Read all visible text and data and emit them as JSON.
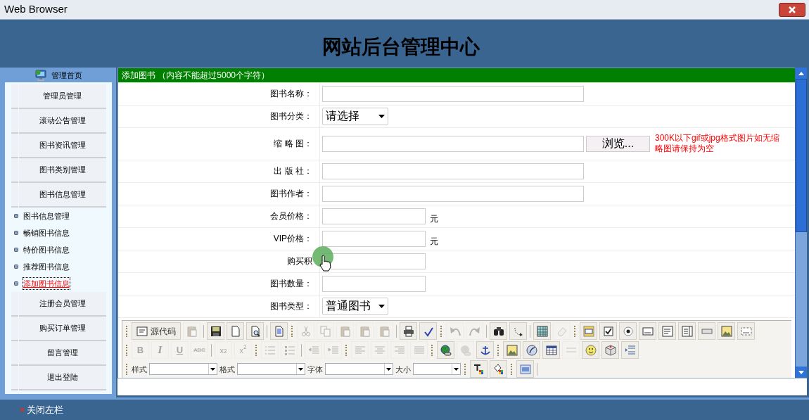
{
  "window": {
    "title": "Web Browser"
  },
  "header": {
    "title": "网站后台管理中心"
  },
  "sidebar": {
    "home": "管理首页",
    "items": [
      {
        "kind": "section",
        "label": "管理员管理"
      },
      {
        "kind": "section",
        "label": "滚动公告管理"
      },
      {
        "kind": "section",
        "label": "图书资讯管理"
      },
      {
        "kind": "section",
        "label": "图书类别管理"
      },
      {
        "kind": "section",
        "label": "图书信息管理"
      },
      {
        "kind": "link",
        "label": "图书信息管理",
        "selected": false
      },
      {
        "kind": "link",
        "label": "畅销图书信息",
        "selected": false
      },
      {
        "kind": "link",
        "label": "特价图书信息",
        "selected": false
      },
      {
        "kind": "link",
        "label": "推荐图书信息",
        "selected": false
      },
      {
        "kind": "link",
        "label": "添加图书信息",
        "selected": true
      },
      {
        "kind": "section",
        "label": "注册会员管理"
      },
      {
        "kind": "section",
        "label": "购买订单管理"
      },
      {
        "kind": "section",
        "label": "留言管理"
      },
      {
        "kind": "section",
        "label": "退出登陆"
      }
    ]
  },
  "form": {
    "title": "添加图书 （内容不能超过5000个字符）",
    "fields": [
      {
        "kind": "text",
        "label": "图书名称："
      },
      {
        "kind": "select",
        "label": "图书分类：",
        "value": "请选择"
      },
      {
        "kind": "file",
        "label": "缩 略 图：",
        "button": "浏览...",
        "hint": "300K以下gif或jpg格式图片如无缩略图请保持为空"
      },
      {
        "kind": "text",
        "label": "出 版 社："
      },
      {
        "kind": "text",
        "label": "图书作者："
      },
      {
        "kind": "short",
        "label": "会员价格：",
        "unit": "元"
      },
      {
        "kind": "short",
        "label": "VIP价格：",
        "unit": "元"
      },
      {
        "kind": "short",
        "label": "购买积"
      },
      {
        "kind": "short",
        "label": "图书数量："
      },
      {
        "kind": "select",
        "label": "图书类型：",
        "value": "普通图书"
      }
    ]
  },
  "editor": {
    "toolbars": [
      {
        "items": [
          {
            "kind": "grip"
          },
          {
            "kind": "labeled",
            "text": "源代码",
            "disabled": false
          },
          {
            "kind": "icon",
            "disabled": true
          },
          {
            "kind": "sep"
          },
          {
            "kind": "icon",
            "disabled": false
          },
          {
            "kind": "icon",
            "disabled": false
          },
          {
            "kind": "icon",
            "disabled": false
          },
          {
            "kind": "sep"
          },
          {
            "kind": "icon",
            "disabled": false
          },
          {
            "kind": "grip"
          },
          {
            "kind": "icon",
            "disabled": true
          },
          {
            "kind": "icon",
            "disabled": true
          },
          {
            "kind": "icon",
            "disabled": true
          },
          {
            "kind": "icon",
            "disabled": true
          },
          {
            "kind": "icon",
            "disabled": true
          },
          {
            "kind": "sep"
          },
          {
            "kind": "icon",
            "disabled": false
          },
          {
            "kind": "icon",
            "disabled": false
          },
          {
            "kind": "grip"
          },
          {
            "kind": "icon",
            "disabled": true
          },
          {
            "kind": "icon",
            "disabled": true
          },
          {
            "kind": "sep"
          },
          {
            "kind": "icon",
            "disabled": false
          },
          {
            "kind": "icon",
            "disabled": false
          },
          {
            "kind": "sep"
          },
          {
            "kind": "icon",
            "disabled": false
          },
          {
            "kind": "icon",
            "disabled": true
          },
          {
            "kind": "grip"
          },
          {
            "kind": "icon",
            "disabled": false
          },
          {
            "kind": "icon",
            "disabled": false
          },
          {
            "kind": "icon",
            "disabled": false
          },
          {
            "kind": "icon",
            "disabled": false
          },
          {
            "kind": "icon",
            "disabled": false
          },
          {
            "kind": "icon",
            "disabled": false
          },
          {
            "kind": "icon",
            "disabled": false
          },
          {
            "kind": "icon",
            "disabled": false
          },
          {
            "kind": "icon",
            "disabled": false
          }
        ]
      },
      {
        "items": [
          {
            "kind": "grip"
          },
          {
            "kind": "text",
            "text": "B",
            "disabled": true
          },
          {
            "kind": "text",
            "text": "I",
            "disabled": true
          },
          {
            "kind": "text",
            "text": "U",
            "disabled": true
          },
          {
            "kind": "text",
            "text": "ABC",
            "disabled": true
          },
          {
            "kind": "sep"
          },
          {
            "kind": "text",
            "text": "x$_{2}$",
            "disabled": true
          },
          {
            "kind": "text",
            "text": "x$^{2}$",
            "disabled": true
          },
          {
            "kind": "grip"
          },
          {
            "kind": "icon",
            "disabled": true
          },
          {
            "kind": "icon",
            "disabled": true
          },
          {
            "kind": "sep"
          },
          {
            "kind": "icon",
            "disabled": true
          },
          {
            "kind": "icon",
            "disabled": true
          },
          {
            "kind": "grip"
          },
          {
            "kind": "icon",
            "disabled": true
          },
          {
            "kind": "icon",
            "disabled": true
          },
          {
            "kind": "icon",
            "disabled": true
          },
          {
            "kind": "icon",
            "disabled": true
          },
          {
            "kind": "grip"
          },
          {
            "kind": "icon",
            "disabled": false
          },
          {
            "kind": "icon",
            "disabled": true
          },
          {
            "kind": "icon",
            "disabled": false
          },
          {
            "kind": "grip"
          },
          {
            "kind": "icon",
            "disabled": false
          },
          {
            "kind": "icon",
            "disabled": false
          },
          {
            "kind": "icon",
            "disabled": false
          },
          {
            "kind": "icon",
            "disabled": true
          },
          {
            "kind": "icon",
            "disabled": false
          },
          {
            "kind": "icon",
            "disabled": false
          },
          {
            "kind": "icon",
            "disabled": false
          }
        ]
      },
      {
        "items": [
          {
            "kind": "grip"
          },
          {
            "kind": "label",
            "text": "样式"
          },
          {
            "kind": "dropdown"
          },
          {
            "kind": "label",
            "text": "格式"
          },
          {
            "kind": "dropdown"
          },
          {
            "kind": "label",
            "text": "字体"
          },
          {
            "kind": "dropdown"
          },
          {
            "kind": "label",
            "text": "大小"
          },
          {
            "kind": "dropdown"
          },
          {
            "kind": "grip"
          },
          {
            "kind": "icon",
            "disabled": false
          },
          {
            "kind": "icon",
            "disabled": false
          },
          {
            "kind": "grip"
          },
          {
            "kind": "icon",
            "disabled": false
          },
          {
            "kind": "sep"
          }
        ]
      }
    ]
  },
  "footer": {
    "toggle": "关闭左栏"
  }
}
